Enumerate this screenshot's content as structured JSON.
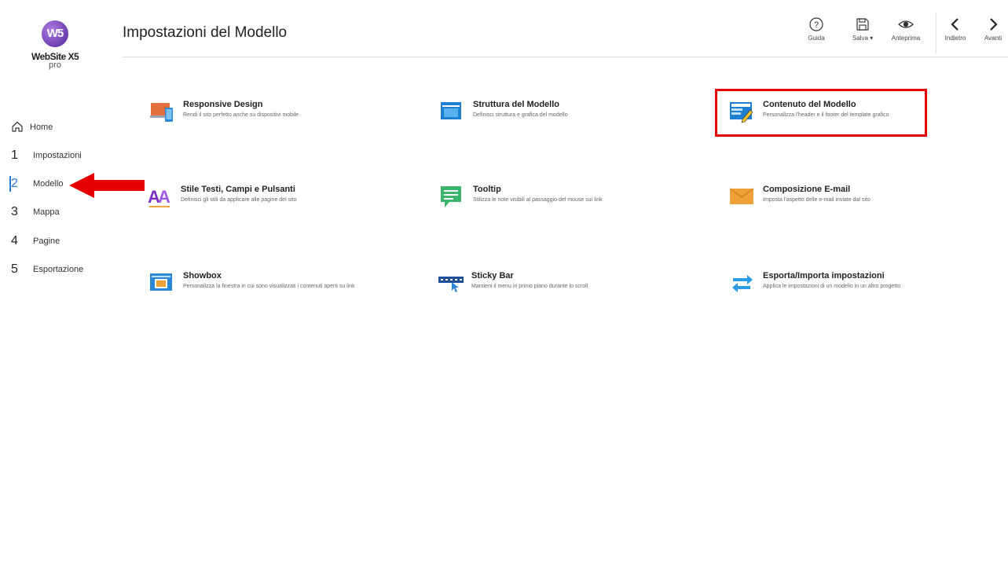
{
  "app": {
    "logo_text": "W5",
    "name": "WebSite X5",
    "edition": "pro"
  },
  "header": {
    "title": "Impostazioni del Modello"
  },
  "toolbar": {
    "help": "Guida",
    "save": "Salva ▾",
    "preview": "Anteprima",
    "back": "Indietro",
    "forward": "Avanti"
  },
  "sidebar": {
    "home": "Home",
    "steps": [
      {
        "num": "1",
        "label": "Impostazioni"
      },
      {
        "num": "2",
        "label": "Modello"
      },
      {
        "num": "3",
        "label": "Mappa"
      },
      {
        "num": "4",
        "label": "Pagine"
      },
      {
        "num": "5",
        "label": "Esportazione"
      }
    ],
    "active_step": "2"
  },
  "items": [
    {
      "title": "Responsive Design",
      "desc": "Rendi il sito perfetto anche su dispositivi mobile",
      "icon": "devices-icon"
    },
    {
      "title": "Struttura del Modello",
      "desc": "Definisci struttura e grafica del modello",
      "icon": "layout-icon"
    },
    {
      "title": "Contenuto del Modello",
      "desc": "Personalizza l'header e il footer del template grafico",
      "icon": "template-edit-icon"
    },
    {
      "title": "Stile Testi, Campi e Pulsanti",
      "desc": "Definisci gli stili da applicare alle pagine del sito",
      "icon": "text-style-icon"
    },
    {
      "title": "Tooltip",
      "desc": "Stilizza le note visibili al passaggio del mouse sui link",
      "icon": "tooltip-icon"
    },
    {
      "title": "Composizione E-mail",
      "desc": "Imposta l'aspetto delle e-mail inviate dal sito",
      "icon": "envelope-icon"
    },
    {
      "title": "Showbox",
      "desc": "Personalizza la finestra in cui sono visualizzati i contenuti aperti su link",
      "icon": "showbox-icon"
    },
    {
      "title": "Sticky Bar",
      "desc": "Mantieni il menu in primo piano durante lo scroll",
      "icon": "sticky-bar-icon"
    },
    {
      "title": "Esporta/Importa impostazioni",
      "desc": "Applica le impostazioni di un modello in un altro progetto",
      "icon": "export-import-icon"
    }
  ],
  "colors": {
    "accent": "#2a7ad5",
    "highlight": "#e60000",
    "brand": "#6b3fb0"
  }
}
